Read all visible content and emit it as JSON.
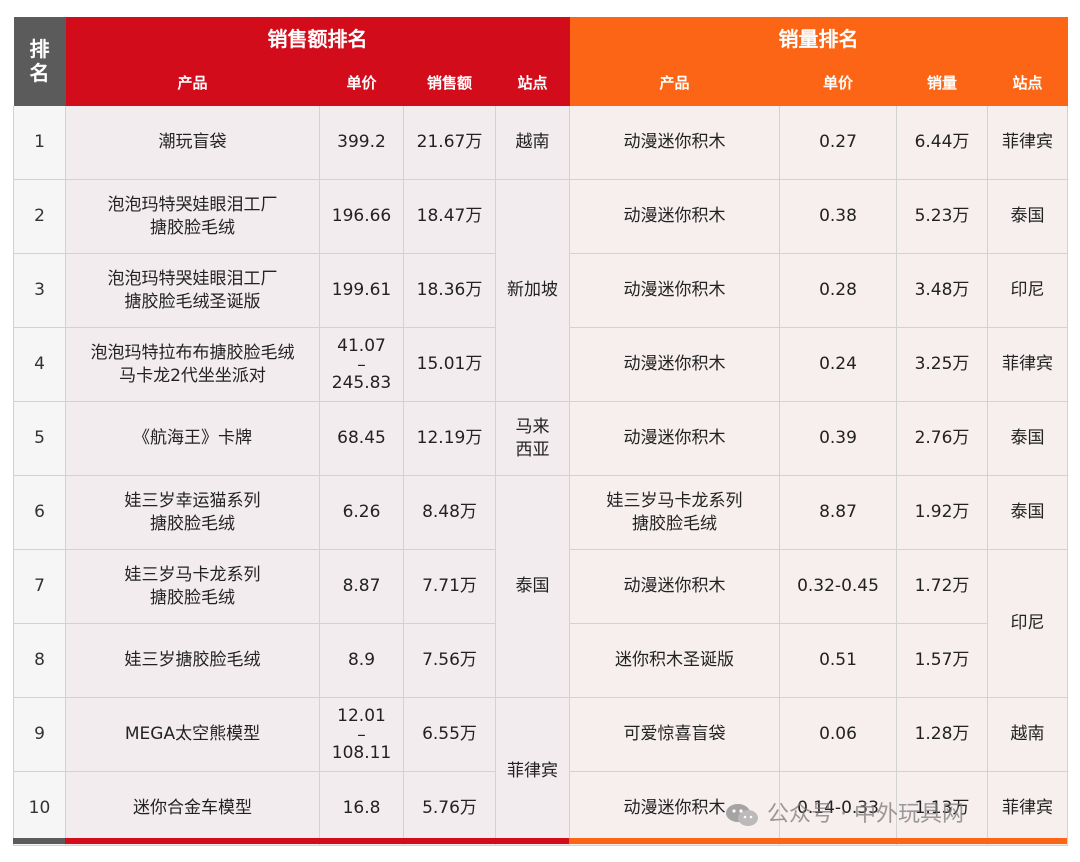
{
  "header": {
    "rank": "排\n名",
    "sales_title": "销售额排名",
    "volume_title": "销量排名"
  },
  "columns": {
    "sales": [
      "产品",
      "单价",
      "销售额",
      "站点"
    ],
    "volume": [
      "产品",
      "单价",
      "销量",
      "站点"
    ]
  },
  "rows": [
    {
      "rank": "1",
      "s_product": "潮玩盲袋",
      "s_price": "399.2",
      "s_amount": "21.67万",
      "v_product": "动漫迷你积木",
      "v_price": "0.27",
      "v_count": "6.44万",
      "v_site": "菲律宾"
    },
    {
      "rank": "2",
      "s_product": "泡泡玛特哭娃眼泪工厂\n搪胶脸毛绒",
      "s_price": "196.66",
      "s_amount": "18.47万",
      "v_product": "动漫迷你积木",
      "v_price": "0.38",
      "v_count": "5.23万",
      "v_site": "泰国"
    },
    {
      "rank": "3",
      "s_product": "泡泡玛特哭娃眼泪工厂\n搪胶脸毛绒圣诞版",
      "s_price": "199.61",
      "s_amount": "18.36万",
      "v_product": "动漫迷你积木",
      "v_price": "0.28",
      "v_count": "3.48万",
      "v_site": "印尼"
    },
    {
      "rank": "4",
      "s_product": "泡泡玛特拉布布搪胶脸毛绒\n马卡龙2代坐坐派对",
      "s_price_top": "41.07",
      "s_price_sep": "–",
      "s_price_bottom": "245.83",
      "s_amount": "15.01万",
      "v_product": "动漫迷你积木",
      "v_price": "0.24",
      "v_count": "3.25万",
      "v_site": "菲律宾"
    },
    {
      "rank": "5",
      "s_product": "《航海王》卡牌",
      "s_price": "68.45",
      "s_amount": "12.19万",
      "v_product": "动漫迷你积木",
      "v_price": "0.39",
      "v_count": "2.76万",
      "v_site": "泰国"
    },
    {
      "rank": "6",
      "s_product": "娃三岁幸运猫系列\n搪胶脸毛绒",
      "s_price": "6.26",
      "s_amount": "8.48万",
      "v_product": "娃三岁马卡龙系列\n搪胶脸毛绒",
      "v_price": "8.87",
      "v_count": "1.92万",
      "v_site": "泰国"
    },
    {
      "rank": "7",
      "s_product": "娃三岁马卡龙系列\n搪胶脸毛绒",
      "s_price": "8.87",
      "s_amount": "7.71万",
      "v_product": "动漫迷你积木",
      "v_price": "0.32-0.45",
      "v_count": "1.72万"
    },
    {
      "rank": "8",
      "s_product": "娃三岁搪胶脸毛绒",
      "s_price": "8.9",
      "s_amount": "7.56万",
      "v_product": "迷你积木圣诞版",
      "v_price": "0.51",
      "v_count": "1.57万"
    },
    {
      "rank": "9",
      "s_product": "MEGA太空熊模型",
      "s_price_top": "12.01",
      "s_price_sep": "–",
      "s_price_bottom": "108.11",
      "s_amount": "6.55万",
      "v_product": "可爱惊喜盲袋",
      "v_price": "0.06",
      "v_count": "1.28万",
      "v_site": "越南"
    },
    {
      "rank": "10",
      "s_product": "迷你合金车模型",
      "s_price": "16.8",
      "s_amount": "5.76万",
      "v_product": "动漫迷你积木",
      "v_price": "0.14-0.33",
      "v_count": "1.13万",
      "v_site": "菲律宾"
    }
  ],
  "sales_sites": {
    "r1": "越南",
    "r2_4": "新加坡",
    "r5": "马来\n西亚",
    "r6_8": "泰国",
    "r9_10": "菲律宾"
  },
  "volume_sites_merged": {
    "r7_8": "印尼"
  },
  "watermark": "公众号 · 中外玩具网",
  "colors": {
    "red": "#d30c1c",
    "orange": "#fb6515",
    "gray": "#5b5b5b"
  }
}
